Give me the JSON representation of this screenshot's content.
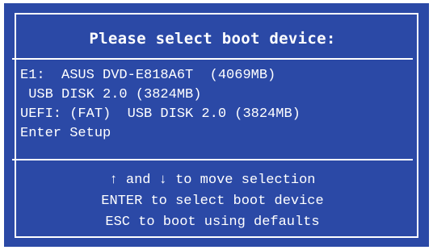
{
  "dialog": {
    "title": "Please select boot device:"
  },
  "menu": {
    "items": [
      {
        "label": "E1:  ASUS DVD-E818A6T  (4069MB)"
      },
      {
        "label": " USB DISK 2.0 (3824MB)"
      },
      {
        "label": "UEFI: (FAT)  USB DISK 2.0 (3824MB)"
      },
      {
        "label": "Enter Setup"
      }
    ]
  },
  "hints": {
    "navigate": "↑ and ↓ to move selection",
    "enter": "ENTER to select boot device",
    "esc": "ESC to boot using defaults"
  },
  "colors": {
    "background": "#2b49a6",
    "foreground": "#ffffff"
  }
}
